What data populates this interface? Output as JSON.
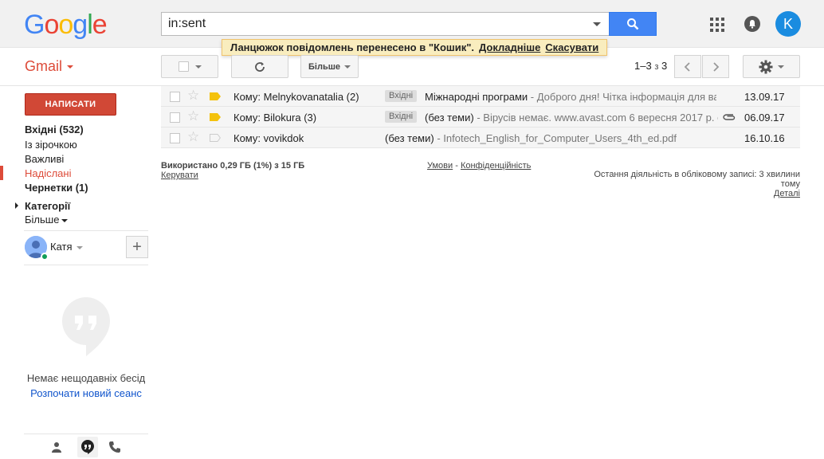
{
  "header": {
    "logo_letters": [
      "G",
      "o",
      "o",
      "g",
      "l",
      "e"
    ],
    "search_value": "in:sent",
    "avatar_letter": "K"
  },
  "notice": {
    "text": "Ланцюжок повідомлень перенесено в \"Кошик\".",
    "learn_more": "Докладніше",
    "undo": "Скасувати"
  },
  "toolbar": {
    "gmail_label": "Gmail",
    "more_label": "Більше",
    "pager_range": "1–3",
    "pager_of": "з",
    "pager_total": "3"
  },
  "sidebar": {
    "compose": "НАПИСАТИ",
    "items": [
      {
        "label": "Вхідні (532)",
        "bold": true
      },
      {
        "label": "Із зірочкою",
        "bold": false
      },
      {
        "label": "Важливі",
        "bold": false
      },
      {
        "label": "Надіслані",
        "bold": false,
        "active": true
      },
      {
        "label": "Чернетки (1)",
        "bold": true
      }
    ],
    "categories": "Категорії",
    "more": "Більше",
    "user_name": "Катя",
    "no_chats": "Немає нещодавніх бесід",
    "start_chat": "Розпочати новий сеанс"
  },
  "mails": [
    {
      "to": "Кому: Melnykovanatalia (2)",
      "label": "Вхідні",
      "subject": "Міжнародні програми",
      "snippet": " - Доброго дня! Чітка інформація для ва",
      "date": "13.09.17",
      "important": true,
      "attachment": false
    },
    {
      "to": "Кому: Bilokura (3)",
      "label": "Вхідні",
      "subject": "(без теми)",
      "snippet": " - Вірусів немає. www.avast.com 6 вересня 2017 р. о",
      "date": "06.09.17",
      "important": true,
      "attachment": true
    },
    {
      "to": "Кому: vovikdok",
      "label": "",
      "subject": "(без теми)",
      "snippet": " -  Infotech_English_for_Computer_Users_4th_ed.pdf",
      "date": "16.10.16",
      "important": false,
      "attachment": false
    }
  ],
  "footer": {
    "usage": "Використано 0,29 ГБ (1%) з 15 ГБ",
    "manage": "Керувати",
    "terms": "Умови",
    "separator": " - ",
    "privacy": "Конфіденційність",
    "last_activity": "Остання діяльність в обліковому записі: 3 хвилини тому",
    "details": "Деталі"
  },
  "colors": {
    "accent_red": "#dd4b39",
    "search_blue": "#4285f4",
    "important_yellow": "#f4c20d"
  }
}
